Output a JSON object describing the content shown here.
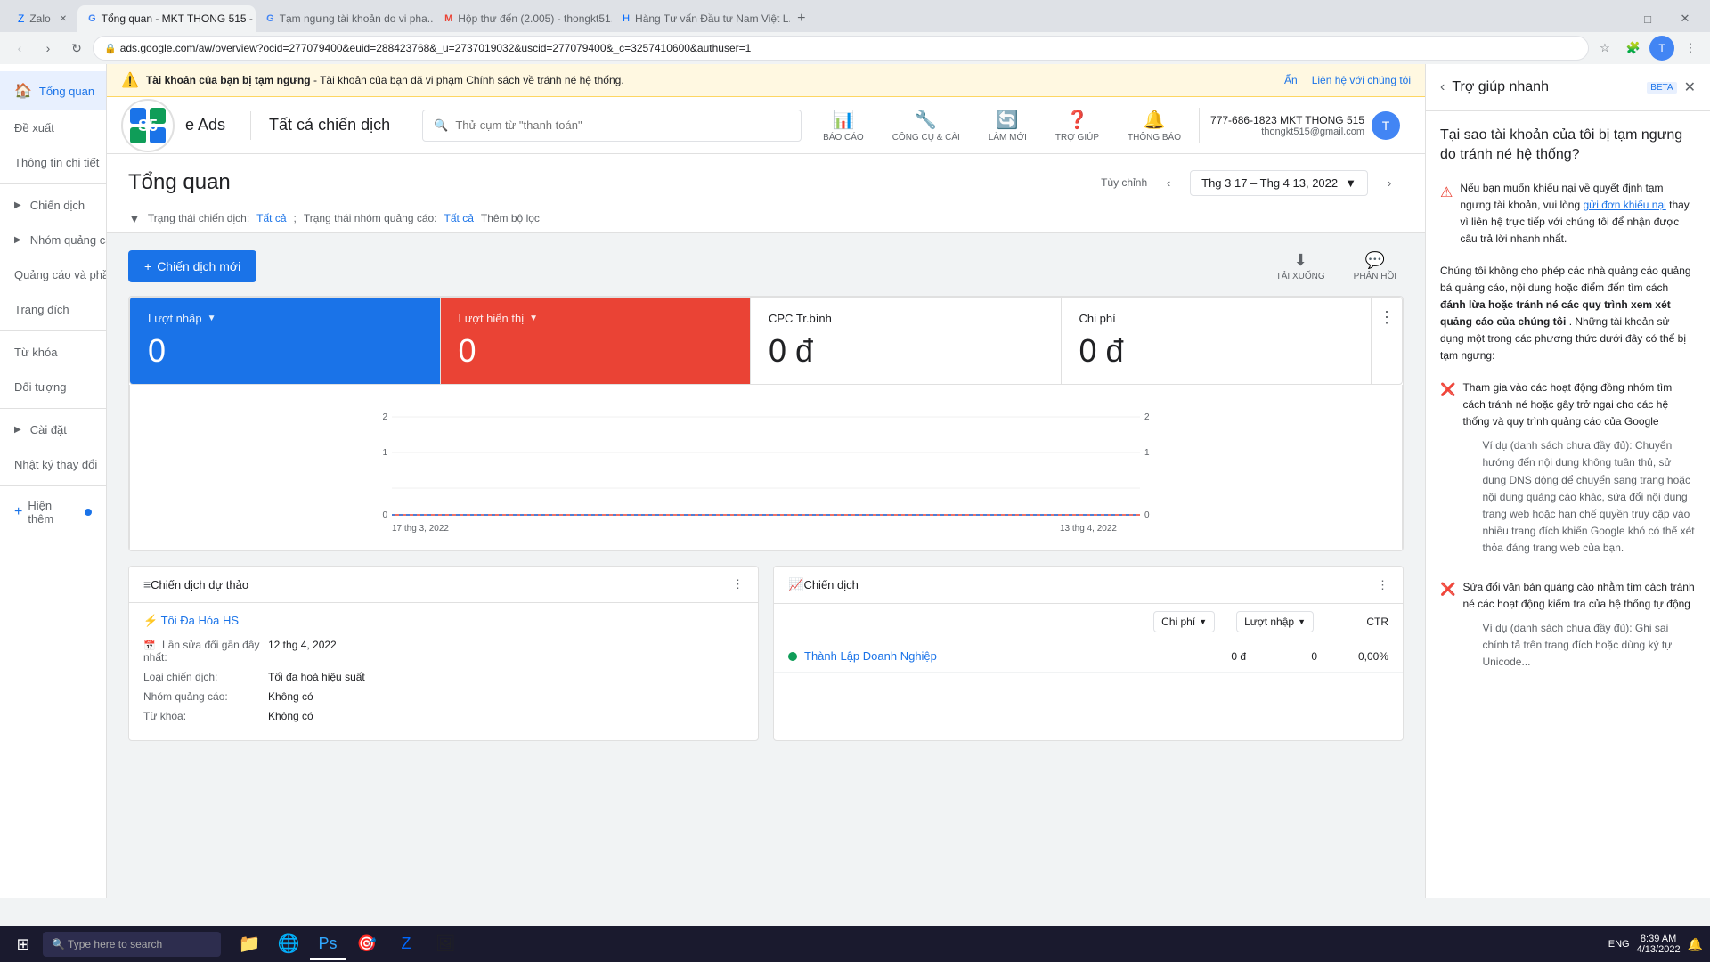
{
  "browser": {
    "address": "ads.google.com/aw/overview?ocid=277079400&euid=288423768&_u=2737019032&uscid=277079400&_c=3257410600&authuser=1",
    "tabs": [
      {
        "id": "tab1",
        "title": "Zalo",
        "favicon_type": "zanh",
        "active": false
      },
      {
        "id": "tab2",
        "title": "Tổng quan - MKT THONG 515 - ...",
        "favicon_type": "google-ads",
        "active": true
      },
      {
        "id": "tab3",
        "title": "Tạm ngưng tài khoản do vi pha...",
        "favicon_type": "google",
        "active": false
      },
      {
        "id": "tab4",
        "title": "Hộp thư đến (2.005) - thongkt51...",
        "favicon_type": "gmail",
        "active": false
      },
      {
        "id": "tab5",
        "title": "Hàng Tư vấn Đầu tư Nam Việt L...",
        "favicon_type": "g",
        "active": false
      }
    ]
  },
  "topnav": {
    "app_name": "e Ads",
    "campaign_label": "Tất cả chiến dịch",
    "search_placeholder": "Thử cụm từ \"thanh toán\"",
    "actions": [
      {
        "id": "bao-cao",
        "label": "BÁO CÁO",
        "icon": "📊"
      },
      {
        "id": "cong-cu",
        "label": "CÔNG CỤ & CÀI",
        "icon": "🔧"
      },
      {
        "id": "lam-moi",
        "label": "LÀM MỚI",
        "icon": "🔄"
      },
      {
        "id": "tro-giup",
        "label": "TRỢ GIÚP",
        "icon": "❓"
      },
      {
        "id": "thong-bao",
        "label": "THÔNG BÁO",
        "icon": "🔔"
      }
    ],
    "user_phone": "777-686-1823 MKT THONG 515",
    "user_email": "thongkt515@gmail.com"
  },
  "warning": {
    "text": "Tài khoản của bạn bị tạm ngưng",
    "detail": "- Tài khoản của bạn đã vi phạm Chính sách về tránh né hệ thống.",
    "hide_label": "Ẩn",
    "contact_label": "Liên hệ với chúng tôi"
  },
  "sidebar": {
    "items": [
      {
        "id": "tong-quan",
        "label": "Tổng quan",
        "icon": "🏠",
        "active": true
      },
      {
        "id": "de-xuat",
        "label": "Đề xuất",
        "icon": ""
      },
      {
        "id": "thong-tin",
        "label": "Thông tin chi tiết",
        "icon": ""
      },
      {
        "id": "chien-dich",
        "label": "Chiến dịch",
        "icon": "",
        "hasArrow": true
      },
      {
        "id": "nhom-quang-cao",
        "label": "Nhóm quảng cáo",
        "icon": "",
        "hasArrow": true
      },
      {
        "id": "quang-cao",
        "label": "Quảng cáo và phần mở rộng",
        "icon": ""
      },
      {
        "id": "trang-dich",
        "label": "Trang đích",
        "icon": ""
      },
      {
        "id": "tu-khoa",
        "label": "Từ khóa",
        "icon": ""
      },
      {
        "id": "doi-tuong",
        "label": "Đối tượng",
        "icon": ""
      },
      {
        "id": "cai-dat",
        "label": "Cài đặt",
        "icon": "",
        "hasArrow": true
      },
      {
        "id": "nhat-ky",
        "label": "Nhật ký thay đổi",
        "icon": ""
      }
    ],
    "show_more_label": "Hiện thêm",
    "show_more_dot": true
  },
  "page": {
    "title": "Tổng quan",
    "tuy_chinh": "Tùy chỉnh",
    "date_range": "Thg 3 17 – Thg 4 13, 2022",
    "filter_campaign_label": "Trạng thái chiến dịch:",
    "filter_campaign_value": "Tất cả",
    "filter_group_label": "Trạng thái nhóm quảng cáo:",
    "filter_group_value": "Tất cả",
    "add_filter_label": "Thêm bộ lọc"
  },
  "actions": {
    "new_campaign_label": "Chiến dịch mới",
    "download_label": "TẢI XUỐNG",
    "feedback_label": "PHẢN HỒI"
  },
  "metrics": [
    {
      "id": "luot-nhap",
      "label": "Lượt nhấp",
      "value": "0",
      "bg": "blue",
      "hasDropdown": true
    },
    {
      "id": "luot-hien-thi",
      "label": "Lượt hiển thị",
      "value": "0",
      "bg": "red",
      "hasDropdown": true
    },
    {
      "id": "cpc",
      "label": "CPC Tr.bình",
      "value": "0 đ",
      "bg": "white"
    },
    {
      "id": "chi-phi",
      "label": "Chi phí",
      "value": "0 đ",
      "bg": "white"
    }
  ],
  "chart": {
    "x_labels": [
      "17 thg 3, 2022",
      "13 thg 4, 2022"
    ],
    "y_left": [
      "2",
      "1",
      "0"
    ],
    "y_right": [
      "2",
      "1",
      "0"
    ]
  },
  "draft_campaign": {
    "title": "Chiến dịch dự thảo",
    "campaign_name": "Tối Đa Hóa HS",
    "last_edit_label": "Lần sửa đổi gần đây nhất:",
    "last_edit_value": "12 thg 4, 2022",
    "type_label": "Loại chiến dịch:",
    "type_value": "Tối đa hoá hiệu suất",
    "group_label": "Nhóm quảng cáo:",
    "group_value": "Không có",
    "keyword_label": "Từ khóa:",
    "keyword_value": "Không có"
  },
  "campaign_panel": {
    "title": "Chiến dịch",
    "col1_label": "Chi phí",
    "col2_label": "Lượt nhập",
    "col3_label": "CTR",
    "rows": [
      {
        "name": "Thành Lập Doanh Nghiệp",
        "cost": "0 đ",
        "clicks": "0",
        "ctr": "0,00%",
        "status_color": "#0f9d58"
      }
    ]
  },
  "help_panel": {
    "title": "Trợ giúp nhanh",
    "beta_label": "BETA",
    "question": "Tại sao tài khoản của tôi bị tạm ngưng do tránh né hệ thống?",
    "warning1": {
      "icon": "⚠️",
      "text": "Nếu bạn muốn khiếu nại về quyết định tạm ngưng tài khoản, vui lòng",
      "link_text": "gửi đơn khiếu nại",
      "text2": "thay vì liên hệ trực tiếp với chúng tôi để nhận được câu trả lời nhanh nhất."
    },
    "intro": "Chúng tôi không cho phép các nhà quảng cáo quảng bá quảng cáo, nội dung hoặc điểm đến tìm cách",
    "intro_bold": "đánh lừa hoặc tránh né các quy trình xem xét quảng cáo của chúng tôi",
    "intro2": ". Những tài khoản sử dụng một trong các phương thức dưới đây có thể bị tạm ngưng:",
    "bullets": [
      {
        "icon": "❌",
        "text": "Tham gia vào các hoạt động đồng nhóm tìm cách tránh né hoặc gây trở ngại cho các hệ thống và quy trình quảng cáo của Google",
        "example": "Ví dụ (danh sách chưa đầy đủ): Chuyển hướng đến nội dung không tuân thủ, sử dụng DNS động để chuyển sang trang hoặc nội dung quảng cáo khác, sửa đổi nội dung trang web hoặc hạn chế quyền truy cập vào nhiều trang đích khiến Google khó có thể xét thỏa đáng trang web của bạn."
      },
      {
        "icon": "❌",
        "text": "Sửa đổi văn bản quảng cáo nhằm tìm cách tránh né các hoạt động kiểm tra của hệ thống tự động",
        "example": "Ví dụ (danh sách chưa đầy đủ): Ghi sai chính tả trên trang đích hoặc dùng ký tự Unicode..."
      }
    ]
  },
  "taskbar": {
    "time": "8:39 AM",
    "date": "4/13/2022",
    "language": "ENG",
    "apps": [
      "🪟",
      "🔍",
      "📁",
      "🌐",
      "📂",
      "⚙️",
      "📸",
      "🎮"
    ]
  }
}
